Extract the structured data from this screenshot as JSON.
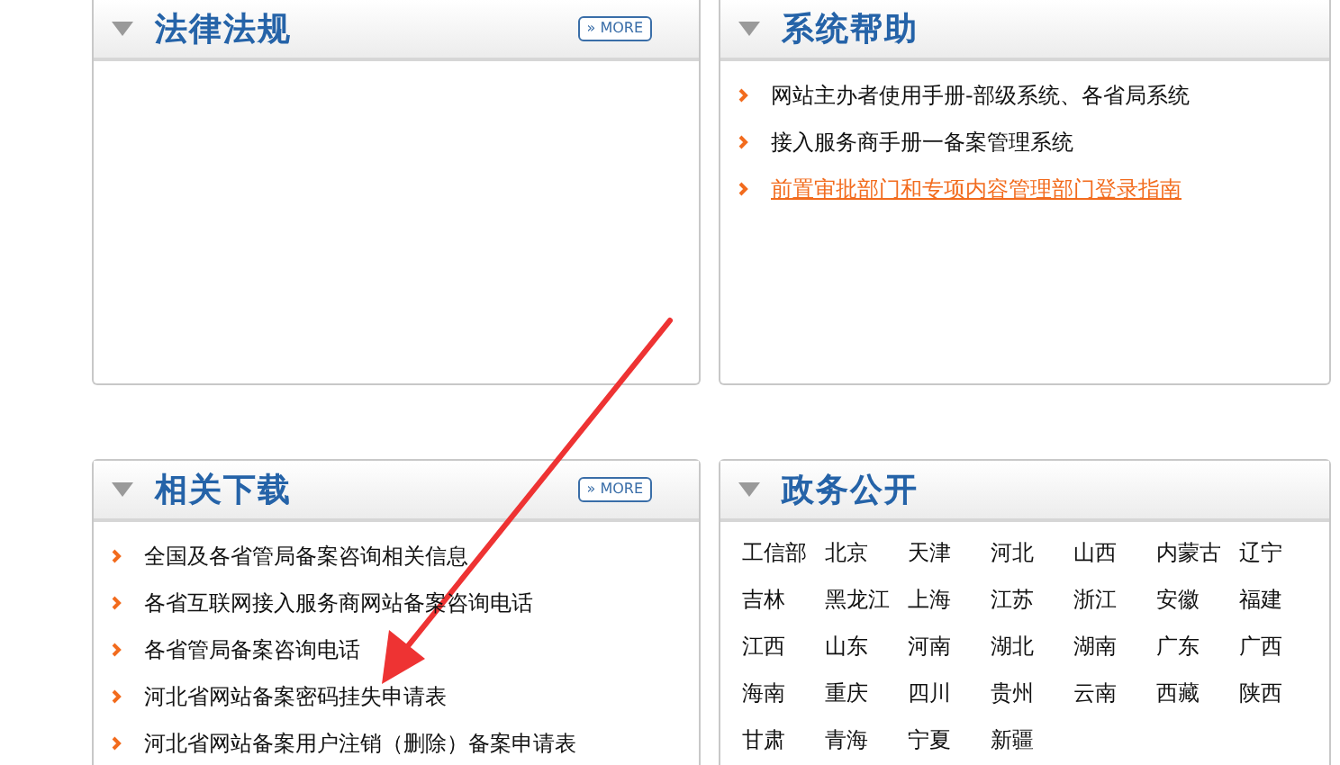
{
  "panels": [
    {
      "kind": "list",
      "title": "法律法规",
      "more": "» MORE"
    },
    {
      "kind": "list",
      "title": "系统帮助",
      "items": [
        {
          "text": "网站主办者使用手册-部级系统、各省局系统",
          "highlighted": false
        },
        {
          "text": "接入服务商手册一备案管理系统",
          "highlighted": false
        },
        {
          "text": "前置审批部门和专项内容管理部门登录指南",
          "highlighted": true
        }
      ]
    },
    {
      "kind": "list",
      "title": "相关下载",
      "more": "» MORE",
      "items": [
        {
          "text": "全国及各省管局备案咨询相关信息",
          "highlighted": false
        },
        {
          "text": "各省互联网接入服务商网站备案咨询电话",
          "highlighted": false
        },
        {
          "text": "各省管局备案咨询电话",
          "highlighted": false
        },
        {
          "text": "河北省网站备案密码挂失申请表",
          "highlighted": false
        },
        {
          "text": "河北省网站备案用户注销（删除）备案申请表",
          "highlighted": false
        }
      ]
    },
    {
      "kind": "grid",
      "title": "政务公开",
      "cells": [
        "工信部",
        "北京",
        "天津",
        "河北",
        "山西",
        "内蒙古",
        "辽宁",
        "吉林",
        "黑龙江",
        "上海",
        "江苏",
        "浙江",
        "安徽",
        "福建",
        "江西",
        "山东",
        "河南",
        "湖北",
        "湖南",
        "广东",
        "广西",
        "海南",
        "重庆",
        "四川",
        "贵州",
        "云南",
        "西藏",
        "陕西",
        "甘肃",
        "青海",
        "宁夏",
        "新疆"
      ]
    }
  ]
}
